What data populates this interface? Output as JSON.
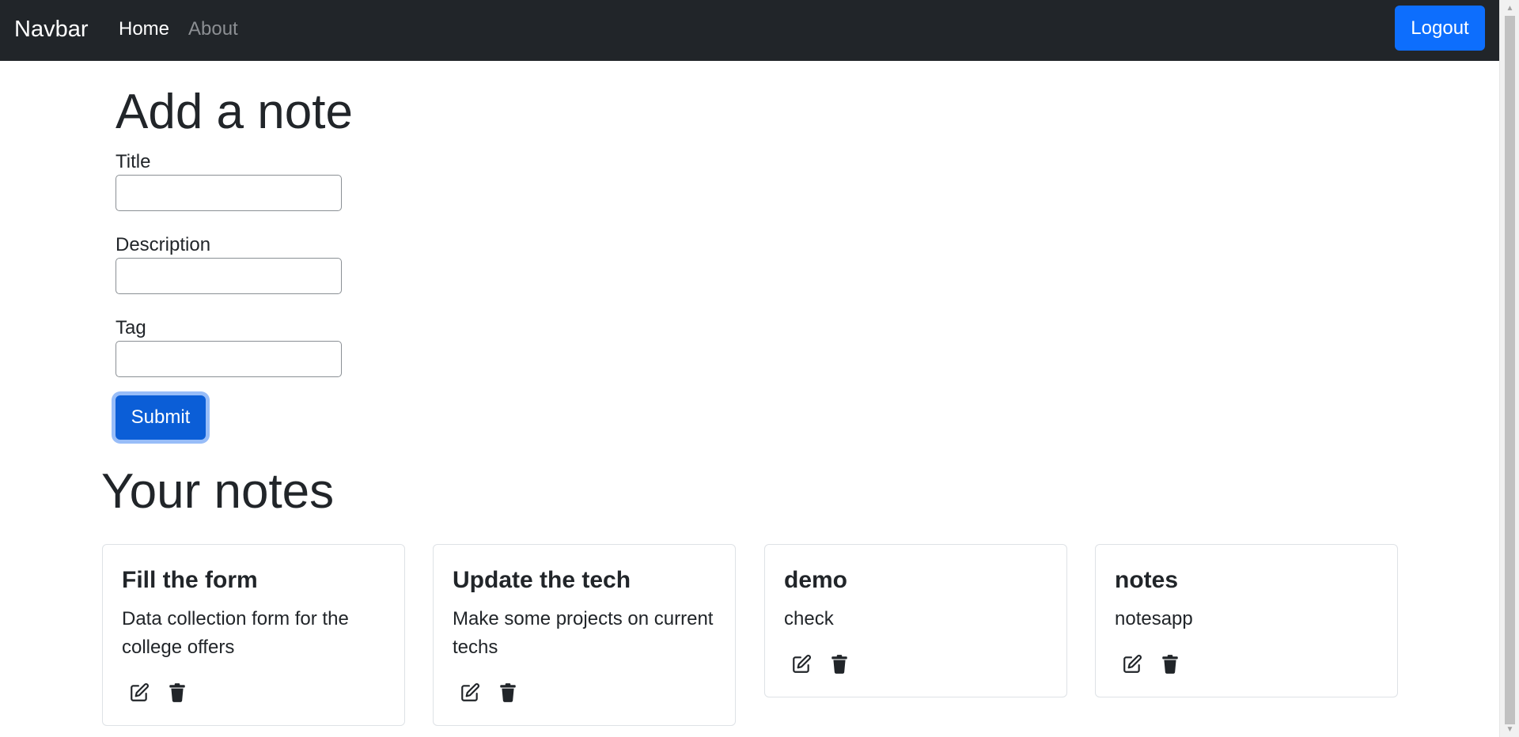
{
  "navbar": {
    "brand": "Navbar",
    "links": [
      {
        "label": "Home",
        "active": true
      },
      {
        "label": "About",
        "active": false
      }
    ],
    "logout_label": "Logout"
  },
  "form": {
    "heading": "Add a note",
    "fields": [
      {
        "label": "Title",
        "value": ""
      },
      {
        "label": "Description",
        "value": ""
      },
      {
        "label": "Tag",
        "value": ""
      }
    ],
    "submit_label": "Submit"
  },
  "notes": {
    "heading": "Your notes",
    "items": [
      {
        "title": "Fill the form",
        "description": "Data collection form for the college offers"
      },
      {
        "title": "Update the tech",
        "description": "Make some projects on current techs"
      },
      {
        "title": "demo",
        "description": "check"
      },
      {
        "title": "notes",
        "description": "notesapp"
      }
    ],
    "edit_icon": "edit-icon",
    "delete_icon": "trash-icon"
  },
  "colors": {
    "navbar_bg": "#212529",
    "primary": "#0d6efd",
    "submit_bg": "#0b5ed7",
    "text": "#212529"
  }
}
